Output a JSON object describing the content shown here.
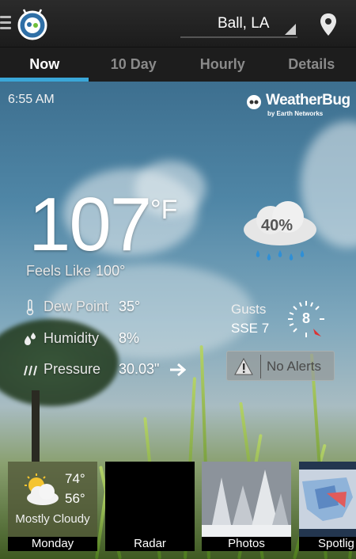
{
  "location": {
    "name": "Ball, LA"
  },
  "tabs": [
    {
      "label": "Now",
      "active": true
    },
    {
      "label": "10 Day",
      "active": false
    },
    {
      "label": "Hourly",
      "active": false
    },
    {
      "label": "Details",
      "active": false
    }
  ],
  "brand": {
    "name": "WeatherBug",
    "sub": "by Earth Networks"
  },
  "now": {
    "time": "6:55 AM",
    "temp": "107",
    "unit": "°F",
    "feels_label": "Feels Like",
    "feels_value": "100°",
    "dew_label": "Dew Point",
    "dew_value": "35°",
    "humidity_label": "Humidity",
    "humidity_value": "8%",
    "pressure_label": "Pressure",
    "pressure_value": "30.03\"",
    "precip_chance": "40%",
    "gusts_label": "Gusts",
    "gusts_value": "SSE 7",
    "wind_speed": "8",
    "alerts_label": "No Alerts"
  },
  "cards": {
    "monday": {
      "title": "Monday",
      "hi": "74°",
      "lo": "56°",
      "desc": "Mostly Cloudy"
    },
    "radar": {
      "title": "Radar"
    },
    "photos": {
      "title": "Photos"
    },
    "spotlight": {
      "title": "Spotlig"
    }
  },
  "colors": {
    "tab_accent": "#3aa7d8",
    "alert_icon": "#e0e0e0"
  },
  "icons": {
    "menu": "menu-icon",
    "app_logo": "weatherbug-logo-icon",
    "pin": "location-pin-icon",
    "dew": "thermometer-icon",
    "humidity": "droplets-icon",
    "pressure": "pressure-icon",
    "pressure_trend": "arrow-right-icon",
    "precip": "rain-cloud-icon",
    "wind": "wind-dial-icon",
    "alert": "warning-icon",
    "monday": "partly-cloudy-icon"
  }
}
